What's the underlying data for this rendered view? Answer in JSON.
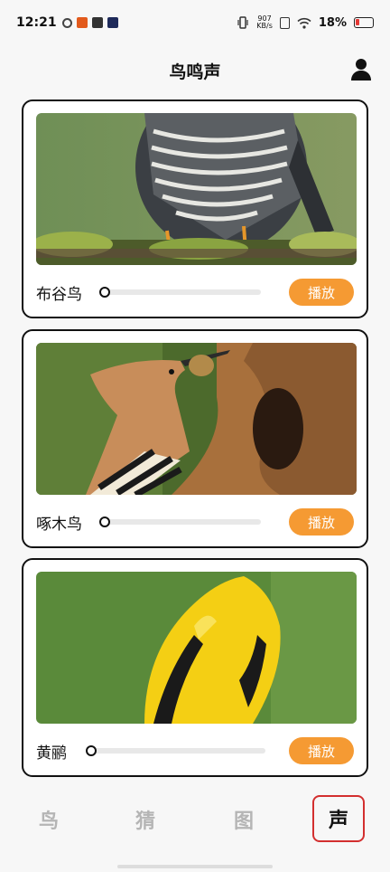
{
  "status_bar": {
    "time": "12:21",
    "net_speed_value": "907",
    "net_speed_unit": "KB/s",
    "battery": "18%",
    "battery_color": "#e53935"
  },
  "header": {
    "title": "鸟鸣声",
    "user_icon": "user-icon"
  },
  "cards": [
    {
      "name": "布谷鸟",
      "play_label": "播放",
      "progress": 0.0,
      "image": "cuckoo-photo"
    },
    {
      "name": "啄木鸟",
      "play_label": "播放",
      "progress": 0.0,
      "image": "hoopoe-photo"
    },
    {
      "name": "黄鹂",
      "play_label": "播放",
      "progress": 0.0,
      "image": "oriole-photo"
    }
  ],
  "bottom_nav": {
    "items": [
      {
        "label": "鸟",
        "active": false
      },
      {
        "label": "猜",
        "active": false
      },
      {
        "label": "图",
        "active": false
      },
      {
        "label": "声",
        "active": true
      }
    ],
    "active_highlight_color": "#d32f2f"
  },
  "accent_color": "#f59a33"
}
